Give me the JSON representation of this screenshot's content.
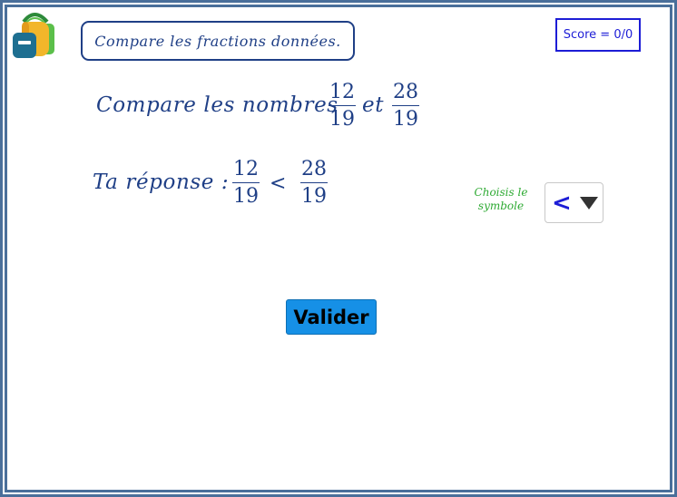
{
  "header": {
    "instruction": "Compare les fractions données.",
    "score": "Score = 0/0"
  },
  "question": {
    "prefix": "Compare les nombres",
    "connector": "et",
    "fraction_a": {
      "numerator": "12",
      "denominator": "19"
    },
    "fraction_b": {
      "numerator": "28",
      "denominator": "19"
    }
  },
  "answer": {
    "prefix": "Ta réponse :",
    "fraction_a": {
      "numerator": "12",
      "denominator": "19"
    },
    "symbol": "<",
    "fraction_b": {
      "numerator": "28",
      "denominator": "19"
    }
  },
  "symbol_picker": {
    "hint_line1": "Choisis le",
    "hint_line2": "symbole",
    "selected": "<"
  },
  "buttons": {
    "validate_label": "Valider"
  },
  "colors": {
    "frame": "#4a6f9a",
    "math_text": "#1f3f86",
    "score_border": "#1d1dd6",
    "hint": "#2eaa33",
    "button": "#1690e6"
  },
  "icons": {
    "logo": "backpack-icon",
    "dropdown": "triangle-down-icon"
  }
}
